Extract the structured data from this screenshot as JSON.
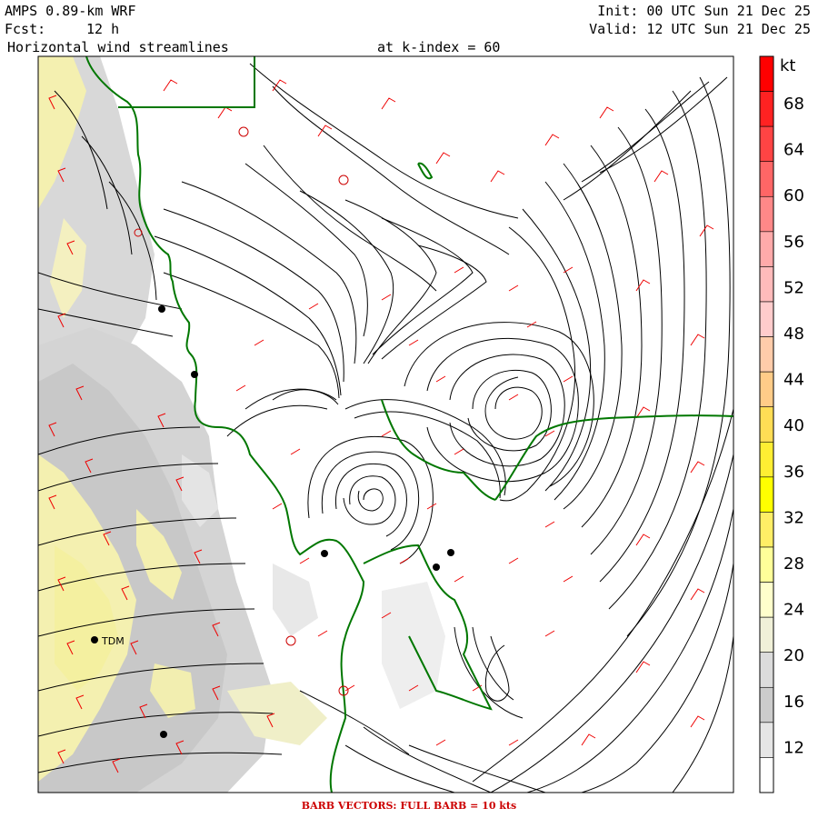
{
  "header": {
    "model": "AMPS 0.89-km WRF",
    "forecast_label": "Fcst:",
    "forecast_value": "12 h",
    "field": "Horizontal wind streamlines",
    "level": "at k-index = 60",
    "init": "Init: 00 UTC Sun 21 Dec 25",
    "valid": "Valid: 12 UTC Sun 21 Dec 25"
  },
  "colorbar": {
    "unit": "kt",
    "ticks": [
      "68",
      "64",
      "60",
      "56",
      "52",
      "48",
      "44",
      "40",
      "36",
      "32",
      "28",
      "24",
      "20",
      "16",
      "12"
    ],
    "colors": [
      "#ffffff",
      "#e6e6e6",
      "#cccccc",
      "#dcdcdc",
      "#f0f0d8",
      "#ffffcc",
      "#ffff99",
      "#ffee66",
      "#ffff00",
      "#ffee33",
      "#ffdd55",
      "#ffcc88",
      "#ffccaa",
      "#ffcccc",
      "#ffbbbb",
      "#ffaaaa",
      "#ff8888",
      "#ff6666",
      "#ff4444",
      "#ff2222",
      "#ff0000"
    ]
  },
  "map": {
    "station_label": "TDM",
    "colors": {
      "coast": "#007700",
      "barb": "#ee0000",
      "streamline": "#000000"
    }
  },
  "footer": "BARB VECTORS:  FULL BARB = 10 kts"
}
